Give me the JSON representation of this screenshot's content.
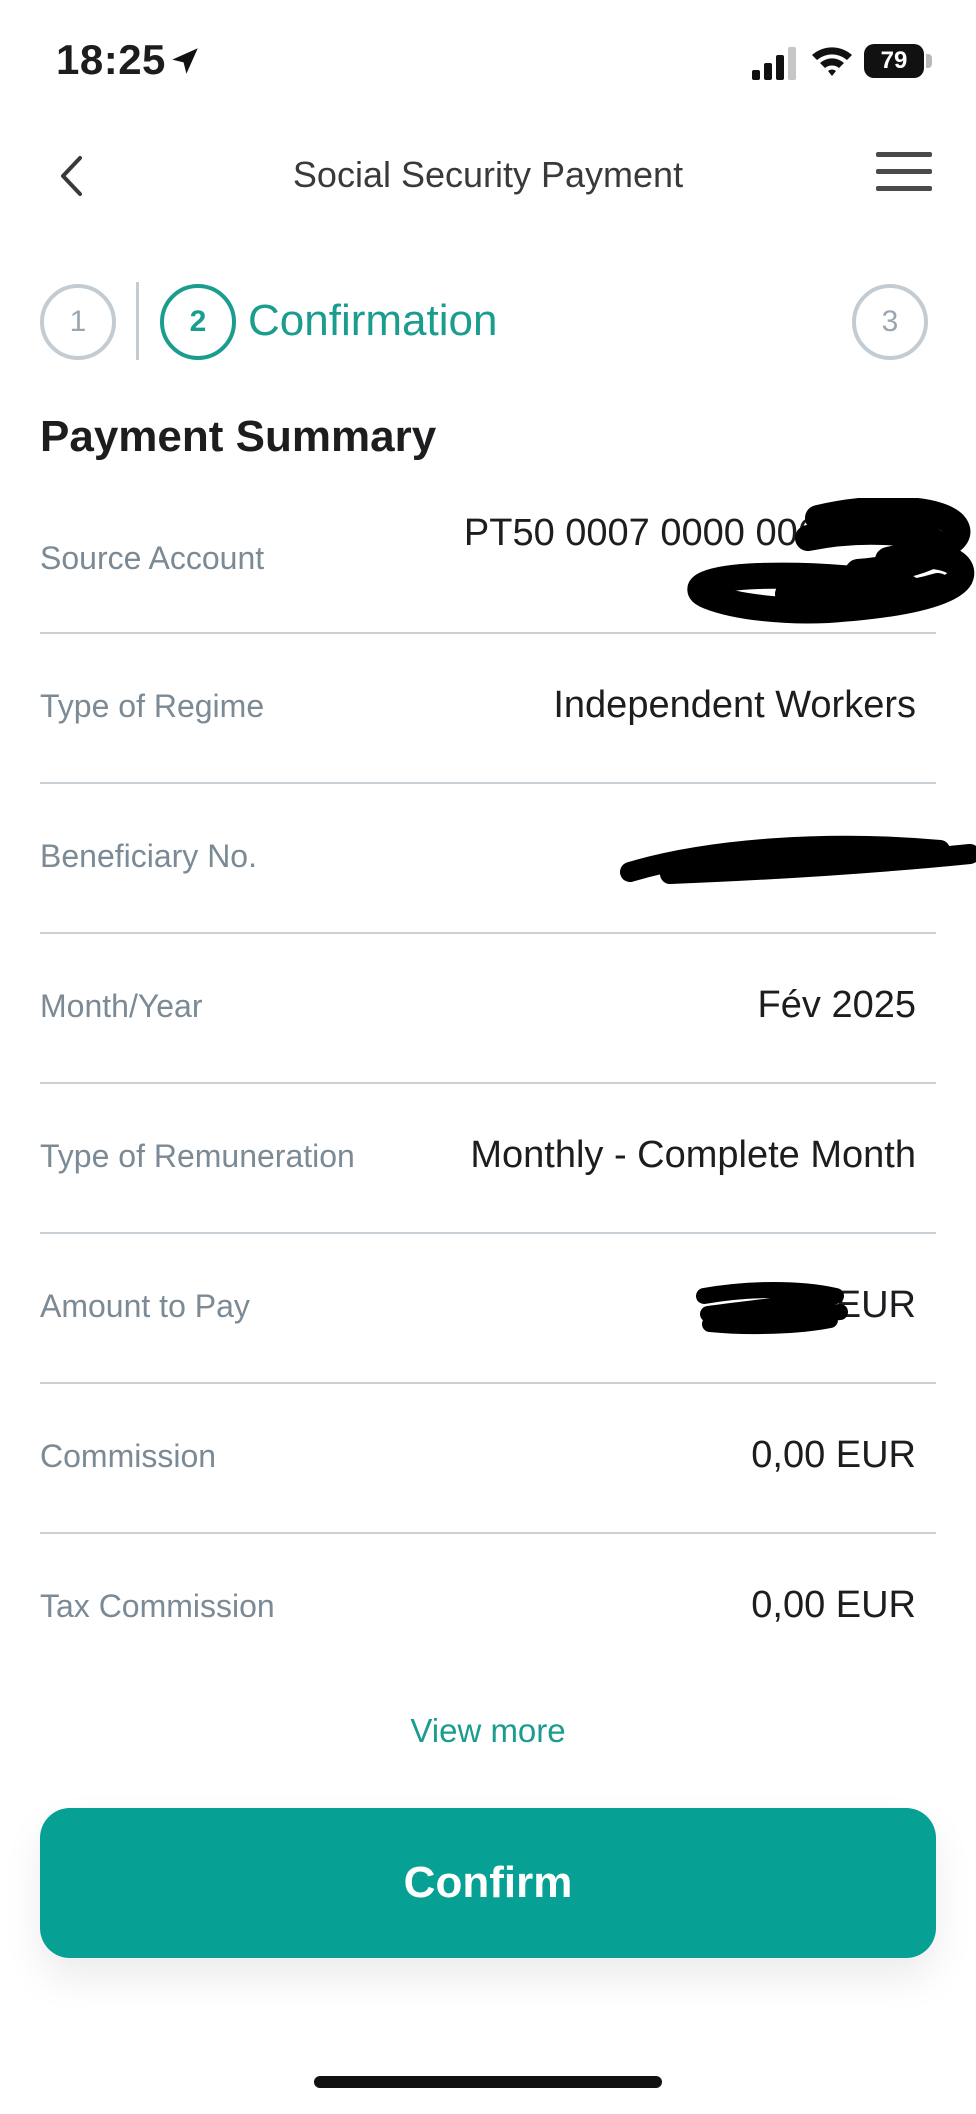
{
  "status_bar": {
    "time": "18:25",
    "battery": "79",
    "icons": [
      "location-arrow-icon",
      "cell-signal-icon",
      "wifi-icon",
      "battery-icon"
    ]
  },
  "header": {
    "title": "Social Security Payment",
    "back_icon": "chevron-left-icon",
    "menu_icon": "hamburger-menu-icon"
  },
  "stepper": {
    "steps": [
      {
        "number": "1",
        "state": "done"
      },
      {
        "number": "2",
        "label": "Confirmation",
        "state": "active"
      },
      {
        "number": "3",
        "state": "pending"
      }
    ],
    "accent_color": "#1a9c8e"
  },
  "summary": {
    "title": "Payment Summary",
    "rows": [
      {
        "label": "Source Account",
        "value": "PT50 0007 0000 0068"
      },
      {
        "label": "Type of Regime",
        "value": "Independent Workers"
      },
      {
        "label": "Beneficiary No.",
        "value": ""
      },
      {
        "label": "Month/Year",
        "value": "Fév 2025"
      },
      {
        "label": "Type of Remuneration",
        "value": "Monthly - Complete Month"
      },
      {
        "label": "Amount to Pay",
        "value": "EUR"
      },
      {
        "label": "Commission",
        "value": "0,00 EUR"
      },
      {
        "label": "Tax Commission",
        "value": "0,00 EUR"
      }
    ]
  },
  "view_more": "View more",
  "confirm_button": {
    "label": "Confirm",
    "color": "#06a094"
  }
}
